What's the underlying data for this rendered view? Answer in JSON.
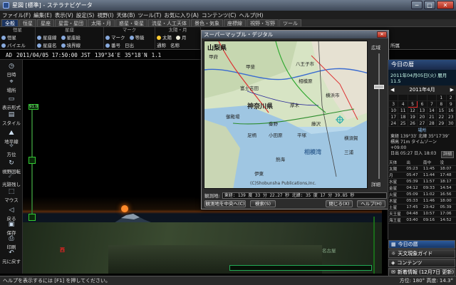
{
  "window": {
    "title": "星図 [標準] - ステラナビゲータ",
    "min": "─",
    "max": "□",
    "close": "✕"
  },
  "menu": [
    "ファイル(F)",
    "編集(E)",
    "表示(V)",
    "設定(S)",
    "視野(I)",
    "天体(B)",
    "ツール(T)",
    "お気に入り(A)",
    "コンテンツ(C)",
    "ヘルプ(H)"
  ],
  "tabs": [
    "全般",
    "恒星",
    "星座",
    "星雲・星団",
    "太陽・月",
    "惑星・衛星",
    "流星・人工天体",
    "景色・気象",
    "座標線",
    "視野・写野",
    "ツール"
  ],
  "toolbar": {
    "g1": {
      "title": "恒星",
      "r1": "恒星",
      "r2": "バイエル"
    },
    "g2": {
      "title": "星座",
      "r1a": "星座線",
      "r1b": "星座絵",
      "r2a": "星座名",
      "r2b": "境界線"
    },
    "g3": {
      "title": "マーク",
      "r1a": "マーク",
      "r1b": "等級",
      "r2": "番号",
      "r3": "日出"
    },
    "g4": {
      "title": "太陽・月",
      "r1a": "太陽",
      "r1b": "月",
      "r2a": "通称",
      "r2b": "名称",
      "r2c": "所属"
    }
  },
  "statusline": {
    "ad": "AD",
    "datetime": "2011/04/05 17:50:00 JST",
    "lon": "139°34′E",
    "lat": "35°18′N",
    "mag": "1.1"
  },
  "sidebar": [
    "日時",
    "場所",
    "表示形式",
    "スタイル",
    "地平線",
    "方位",
    "視野回転",
    "光跡残し",
    "マウス",
    "戻る",
    "保存",
    "印刷",
    "元に戻す"
  ],
  "view": {
    "slider_label": "91.0",
    "red_sign": "西",
    "hill_label": "名古屋"
  },
  "dialog": {
    "title": "スーパーマップル・デジタル",
    "map_title": "山梨県",
    "labels": {
      "kofu": "甲府",
      "kai": "甲斐",
      "hachioji": "八王子市",
      "sagamihara": "相模原",
      "yokohama": "横浜市",
      "kanagawa": "神奈川県",
      "atsugi": "厚木",
      "fujisawa": "藤沢",
      "odawara": "小田原",
      "hiratsuka": "平塚",
      "gotemba": "御殿場",
      "atami": "熱海",
      "sagamiwan": "相模湾",
      "yokosuka": "横須賀",
      "ito": "伊東",
      "fujiyoshida": "富士吉田",
      "miura": "三浦",
      "ashigara": "足柄",
      "hadano": "秦野"
    },
    "copyright": "(C)Shobunsha Publications,Inc.",
    "zoom_wide": "広域",
    "zoom_detail": "詳細",
    "loc_label": "観測地:",
    "loc_value": "東経: 139 度 33 分 22.27 秒  北緯: 35 度 17 分 39.85 秒",
    "btn_set": "観測地を中央へ(C)",
    "btn_search": "検索(S)",
    "btn_close": "閉じる(X)",
    "btn_help": "ヘルプ(H)"
  },
  "rightpanel": {
    "title": "今日の暦",
    "date": "2011年04月05日(火) 暦月11.5",
    "cal_month": "2011年4月",
    "cal_prev": "◀",
    "cal_next": "▶",
    "cal_days": [
      "",
      "",
      "",
      "",
      "",
      "1",
      "2",
      "3",
      "4",
      "5",
      "6",
      "7",
      "8",
      "9",
      "10",
      "11",
      "12",
      "13",
      "14",
      "15",
      "16",
      "17",
      "18",
      "19",
      "20",
      "21",
      "22",
      "23",
      "24",
      "25",
      "26",
      "27",
      "28",
      "29",
      "30"
    ],
    "place_head": "場所",
    "place1": "東経 139°33′ 北緯 35°17′39″",
    "place2": "標高 71m タイムゾーン +09:00",
    "place3": "日出 05:27 日入 18:03",
    "place_btn": "詳細",
    "table_head": [
      "天体",
      "出",
      "南中",
      "没"
    ],
    "table": [
      [
        "太陽",
        "05:23",
        "11:45",
        "18:07"
      ],
      [
        "月",
        "05:47",
        "11:44",
        "17:48"
      ],
      [
        "水星",
        "05:39",
        "11:57",
        "18:17"
      ],
      [
        "金星",
        "04:12",
        "09:33",
        "14:54"
      ],
      [
        "火星",
        "05:09",
        "11:02",
        "16:56"
      ],
      [
        "木星",
        "05:33",
        "11:46",
        "18:00"
      ],
      [
        "土星",
        "17:45",
        "23:42",
        "05:39"
      ],
      [
        "天王星",
        "04:48",
        "10:57",
        "17:06"
      ],
      [
        "海王星",
        "03:40",
        "09:16",
        "14:52"
      ]
    ]
  },
  "rightbuttons": [
    "今日の暦",
    "天文現象ガイド",
    "コンテンツ",
    "新着情報 (12月7日 更新)"
  ],
  "statusbar": {
    "help": "ヘルプを表示するには [F1] を押してください。",
    "azimuth": "方位: 180° 高度: 14.3°"
  }
}
